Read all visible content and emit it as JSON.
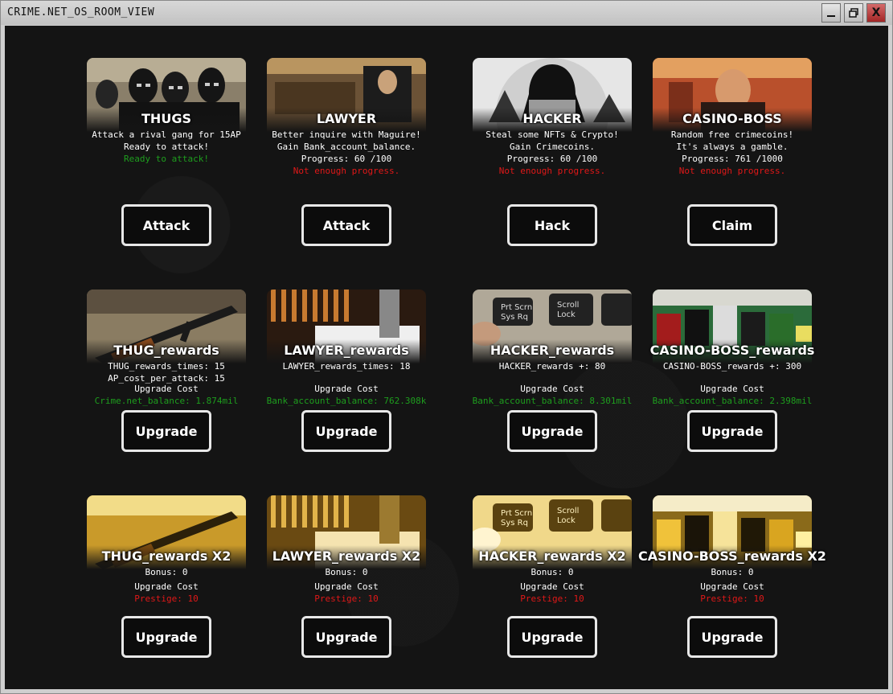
{
  "window": {
    "title": "CRIME.NET_OS_ROOM_VIEW",
    "min_icon": "minimize-icon",
    "max_icon": "maximize-icon",
    "close_label": "X"
  },
  "colors": {
    "green": "#1e9e1e",
    "red": "#e01818",
    "text": "#ffffff",
    "background": "#141414"
  },
  "rows": [
    {
      "cards": [
        {
          "title": "THUGS",
          "lines": [
            "Attack a rival gang for 15AP",
            "Ready to attack!",
            "Ready to attack!"
          ],
          "line_styles": [
            "",
            "",
            "green"
          ],
          "button": "Attack"
        },
        {
          "title": "LAWYER",
          "lines": [
            "Better inquire with Maguire!",
            "Gain Bank_account_balance.",
            "Progress: 60 /100",
            "Not enough progress."
          ],
          "line_styles": [
            "",
            "",
            "",
            "red"
          ],
          "button": "Attack"
        },
        {
          "title": "HACKER",
          "lines": [
            "Steal some NFTs & Crypto!",
            "Gain Crimecoins.",
            "Progress: 60 /100",
            "Not enough progress."
          ],
          "line_styles": [
            "",
            "",
            "",
            "red"
          ],
          "button": "Hack"
        },
        {
          "title": "CASINO-BOSS",
          "lines": [
            "Random free crimecoins!",
            "It's always a gamble.",
            "Progress: 761 /1000",
            "Not enough progress."
          ],
          "line_styles": [
            "",
            "",
            "",
            "red"
          ],
          "button": "Claim"
        }
      ]
    },
    {
      "cards": [
        {
          "title": "THUG_rewards",
          "lines": [
            "THUG_rewards_times: 15",
            "AP_cost_per_attack: 15",
            "Upgrade Cost",
            "Crime.net_balance: 1.874mil"
          ],
          "line_styles": [
            "",
            "",
            "",
            "green"
          ],
          "button": "Upgrade"
        },
        {
          "title": "LAWYER_rewards",
          "lines": [
            "LAWYER_rewards_times: 18",
            "",
            "Upgrade Cost",
            "Bank_account_balance: 762.308k"
          ],
          "line_styles": [
            "",
            "",
            "",
            "green"
          ],
          "button": "Upgrade"
        },
        {
          "title": "HACKER_rewards",
          "lines": [
            "HACKER_rewards +: 80",
            "",
            "Upgrade Cost",
            "Bank_account_balance: 8.301mil"
          ],
          "line_styles": [
            "",
            "",
            "",
            "green"
          ],
          "button": "Upgrade"
        },
        {
          "title": "CASINO-BOSS_rewards",
          "lines": [
            "CASINO-BOSS_rewards +: 300",
            "",
            "Upgrade Cost",
            "Bank_account_balance: 2.398mil"
          ],
          "line_styles": [
            "",
            "",
            "",
            "green"
          ],
          "button": "Upgrade"
        }
      ]
    },
    {
      "cards": [
        {
          "title": "THUG_rewards X2",
          "lines": [
            "Bonus: 0",
            "Upgrade Cost",
            "Prestige: 10"
          ],
          "line_styles": [
            "",
            "",
            "red"
          ],
          "button": "Upgrade"
        },
        {
          "title": "LAWYER_rewards X2",
          "lines": [
            "Bonus: 0",
            "Upgrade Cost",
            "Prestige: 10"
          ],
          "line_styles": [
            "",
            "",
            "red"
          ],
          "button": "Upgrade"
        },
        {
          "title": "HACKER_rewards X2",
          "lines": [
            "Bonus: 0",
            "Upgrade Cost",
            "Prestige: 10"
          ],
          "line_styles": [
            "",
            "",
            "red"
          ],
          "button": "Upgrade"
        },
        {
          "title": "CASINO-BOSS_rewards X2",
          "lines": [
            "Bonus: 0",
            "Upgrade Cost",
            "Prestige: 10"
          ],
          "line_styles": [
            "",
            "",
            "red"
          ],
          "button": "Upgrade"
        }
      ]
    }
  ]
}
